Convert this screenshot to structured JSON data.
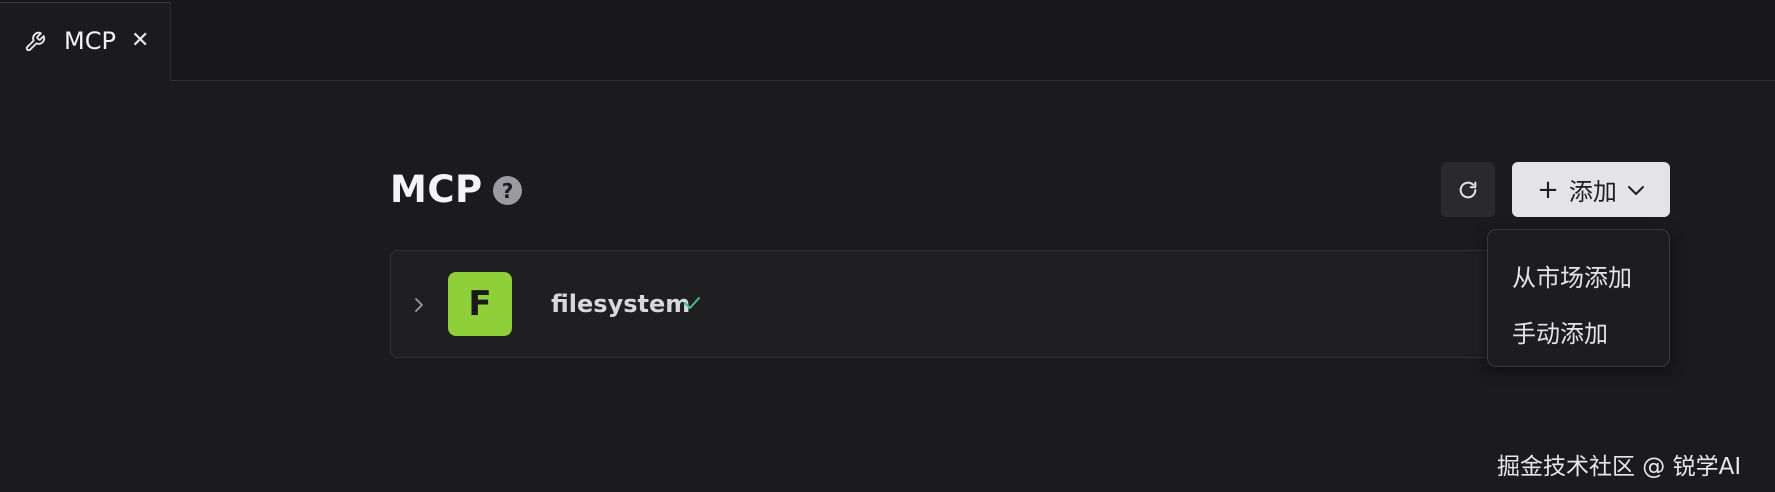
{
  "tab": {
    "icon": "wrench-icon",
    "label": "MCP",
    "close_label": "✕"
  },
  "header": {
    "title": "MCP",
    "help_label": "?",
    "refresh_icon": "refresh-icon",
    "add_button": {
      "plus": "+",
      "label": "添加",
      "chevron_icon": "chevron-down-icon"
    }
  },
  "add_menu": {
    "items": [
      {
        "label": "从市场添加"
      },
      {
        "label": "手动添加"
      }
    ]
  },
  "servers": [
    {
      "avatar_letter": "F",
      "avatar_color": "#8fcf3a",
      "name": "filesystem",
      "status_icon": "check-icon",
      "status_color": "#3fbf7f"
    }
  ],
  "watermark": "掘金技术社区 @ 锐学AI"
}
